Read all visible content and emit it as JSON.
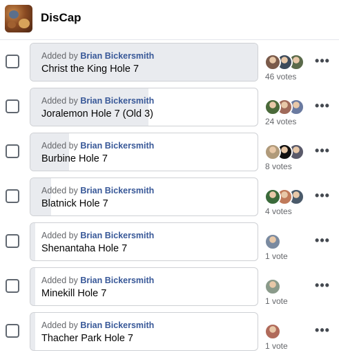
{
  "group": {
    "name": "DisCap"
  },
  "poll": {
    "added_prefix": "Added by",
    "more_glyph": "•••",
    "options": [
      {
        "title": "Christ the King Hole 7",
        "author": "Brian Bickersmith",
        "votes_label": "46 votes",
        "vote_share": 1.0,
        "voters": [
          "#7a5a4a",
          "#3c4a5a",
          "#5a6a4a"
        ]
      },
      {
        "title": "Joralemon Hole 7 (Old 3)",
        "author": "Brian Bickersmith",
        "votes_label": "24 votes",
        "vote_share": 0.52,
        "voters": [
          "#4a6a3a",
          "#a06a5a",
          "#6a7aa0"
        ]
      },
      {
        "title": "Burbine Hole 7",
        "author": "Brian Bickersmith",
        "votes_label": "8 votes",
        "vote_share": 0.17,
        "voters": [
          "#b09a7a",
          "#111111",
          "#5a5a6a"
        ]
      },
      {
        "title": "Blatnick Hole 7",
        "author": "Brian Bickersmith",
        "votes_label": "4 votes",
        "vote_share": 0.09,
        "voters": [
          "#3a6a3a",
          "#c07a5a",
          "#4a5a6a"
        ]
      },
      {
        "title": "Shenantaha Hole 7",
        "author": "Brian Bickersmith",
        "votes_label": "1 vote",
        "vote_share": 0.02,
        "voters": [
          "#7a8aa0"
        ]
      },
      {
        "title": "Minekill Hole 7",
        "author": "Brian Bickersmith",
        "votes_label": "1 vote",
        "vote_share": 0.02,
        "voters": [
          "#8a9a8a"
        ]
      },
      {
        "title": "Thacher Park Hole 7",
        "author": "Brian Bickersmith",
        "votes_label": "1 vote",
        "vote_share": 0.02,
        "voters": [
          "#b06a5a"
        ]
      }
    ]
  }
}
